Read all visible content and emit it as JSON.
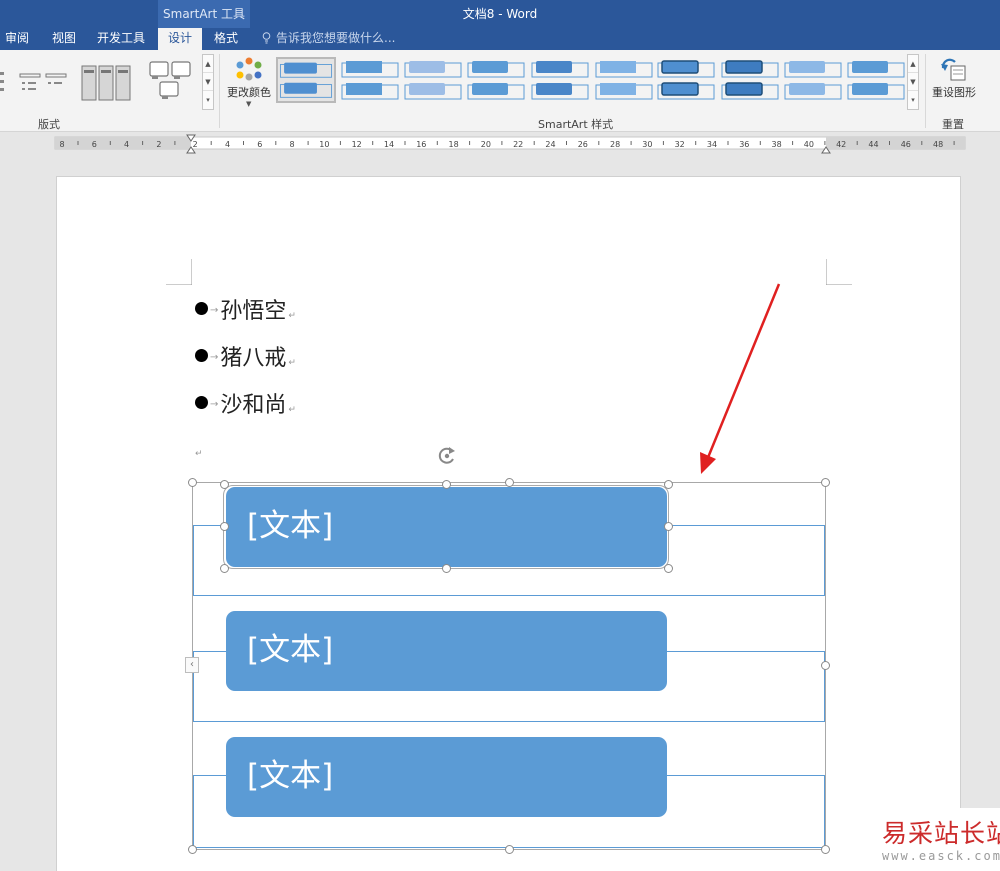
{
  "window": {
    "title": "文档8 - Word",
    "context_tab_group": "SmartArt 工具"
  },
  "tabs": [
    {
      "label": "审阅",
      "active": false
    },
    {
      "label": "视图",
      "active": false
    },
    {
      "label": "开发工具",
      "active": false
    },
    {
      "label": "设计",
      "active": true
    },
    {
      "label": "格式",
      "active": false
    }
  ],
  "tell_me": {
    "text": "告诉我您想要做什么..."
  },
  "ribbon": {
    "groups": {
      "layouts": "版式",
      "smartart_styles": "SmartArt 样式",
      "reset": "重置"
    },
    "change_colors_label": "更改颜色",
    "reset_graphic_label": "重设图形",
    "selected_style_index": 0
  },
  "ruler": {
    "ticks": [
      "8",
      "6",
      "4",
      "2",
      "2",
      "4",
      "6",
      "8",
      "10",
      "12",
      "14",
      "16",
      "18",
      "20",
      "22",
      "24",
      "26",
      "28",
      "30",
      "32",
      "34",
      "36",
      "38",
      "40",
      "42",
      "44",
      "46",
      "48"
    ]
  },
  "document": {
    "list_items": [
      "孙悟空",
      "猪八戒",
      "沙和尚"
    ],
    "smartart_shapes": [
      "[文本]",
      "[文本]",
      "[文本]"
    ]
  },
  "colors": {
    "title_bar": "#2b579a",
    "smartart_fill": "#5b9bd5",
    "annotation_arrow": "#e02020"
  },
  "watermark": {
    "text": "易采站长站",
    "url": "www.easck.com"
  }
}
